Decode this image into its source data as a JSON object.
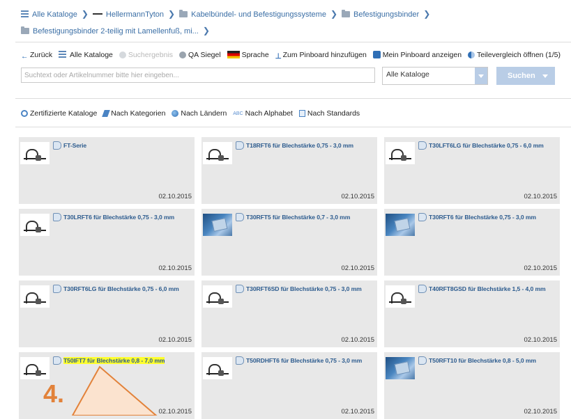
{
  "breadcrumb": {
    "row1": [
      "Alle Kataloge",
      "HellermannTyton",
      "Kabelbündel- und Befestigungssysteme",
      "Befestigungsbinder"
    ],
    "row2": [
      "Befestigungsbinder 2-teilig mit Lamellenfuß, mi..."
    ]
  },
  "toolbar": {
    "back": "Zurück",
    "all_catalogs": "Alle Kataloge",
    "search_result": "Suchergebnis",
    "qa_seal": "QA Siegel",
    "language": "Sprache",
    "add_pinboard": "Zum Pinboard hinzufügen",
    "show_pinboard": "Mein Pinboard anzeigen",
    "compare": "Teilevergleich öffnen (1/5)"
  },
  "search": {
    "placeholder": "Suchtext oder Artikelnummer bitte hier eingeben...",
    "catalog_select": "Alle Kataloge",
    "button": "Suchen"
  },
  "filters": [
    "Zertifizierte Kataloge",
    "Nach Kategorien",
    "Nach Ländern",
    "Nach Alphabet",
    "Nach Standards"
  ],
  "filters_abc_icon": "ABC",
  "cards": [
    {
      "title": "FT-Serie",
      "date": "02.10.2015",
      "thumb": "drawing",
      "highlight": false
    },
    {
      "title": "T18RFT6 für Blechstärke 0,75 - 3,0 mm",
      "date": "02.10.2015",
      "thumb": "drawing",
      "highlight": false
    },
    {
      "title": "T30LFT6LG für Blechstärke 0,75 - 6,0 mm",
      "date": "02.10.2015",
      "thumb": "drawing",
      "highlight": false
    },
    {
      "title": "T30LRFT6 für Blechstärke 0,75 - 3,0 mm",
      "date": "02.10.2015",
      "thumb": "drawing",
      "highlight": false
    },
    {
      "title": "T30RFT5 für Blechstärke 0,7 - 3,0 mm",
      "date": "02.10.2015",
      "thumb": "photo",
      "highlight": false
    },
    {
      "title": "T30RFT6 für Blechstärke 0,75 - 3,0 mm",
      "date": "02.10.2015",
      "thumb": "photo",
      "highlight": false
    },
    {
      "title": "T30RFT6LG für Blechstärke 0,75 - 6,0 mm",
      "date": "02.10.2015",
      "thumb": "drawing",
      "highlight": false
    },
    {
      "title": "T30RFT6SD für Blechstärke 0,75 - 3,0 mm",
      "date": "02.10.2015",
      "thumb": "drawing",
      "highlight": false
    },
    {
      "title": "T40RFT8GSD für Blechstärke 1,5 - 4,0 mm",
      "date": "02.10.2015",
      "thumb": "drawing",
      "highlight": false
    },
    {
      "title": "T50IFT7 für Blechstärke 0,8 - 7,0 mm",
      "date": "02.10.2015",
      "thumb": "drawing",
      "highlight": true
    },
    {
      "title": "T50RDHFT6 für Blechstärke 0,75 - 3,0 mm",
      "date": "02.10.2015",
      "thumb": "drawing",
      "highlight": false
    },
    {
      "title": "T50RFT10 für Blechstärke 0,8 - 5,0 mm",
      "date": "02.10.2015",
      "thumb": "photo",
      "highlight": false
    }
  ],
  "annotation": {
    "number": "4.",
    "color": "#e2823a"
  },
  "colors": {
    "link": "#3a6ea5",
    "card_bg": "#e8e8e8",
    "highlight": "#ffff2d",
    "button": "#b9cde6"
  }
}
